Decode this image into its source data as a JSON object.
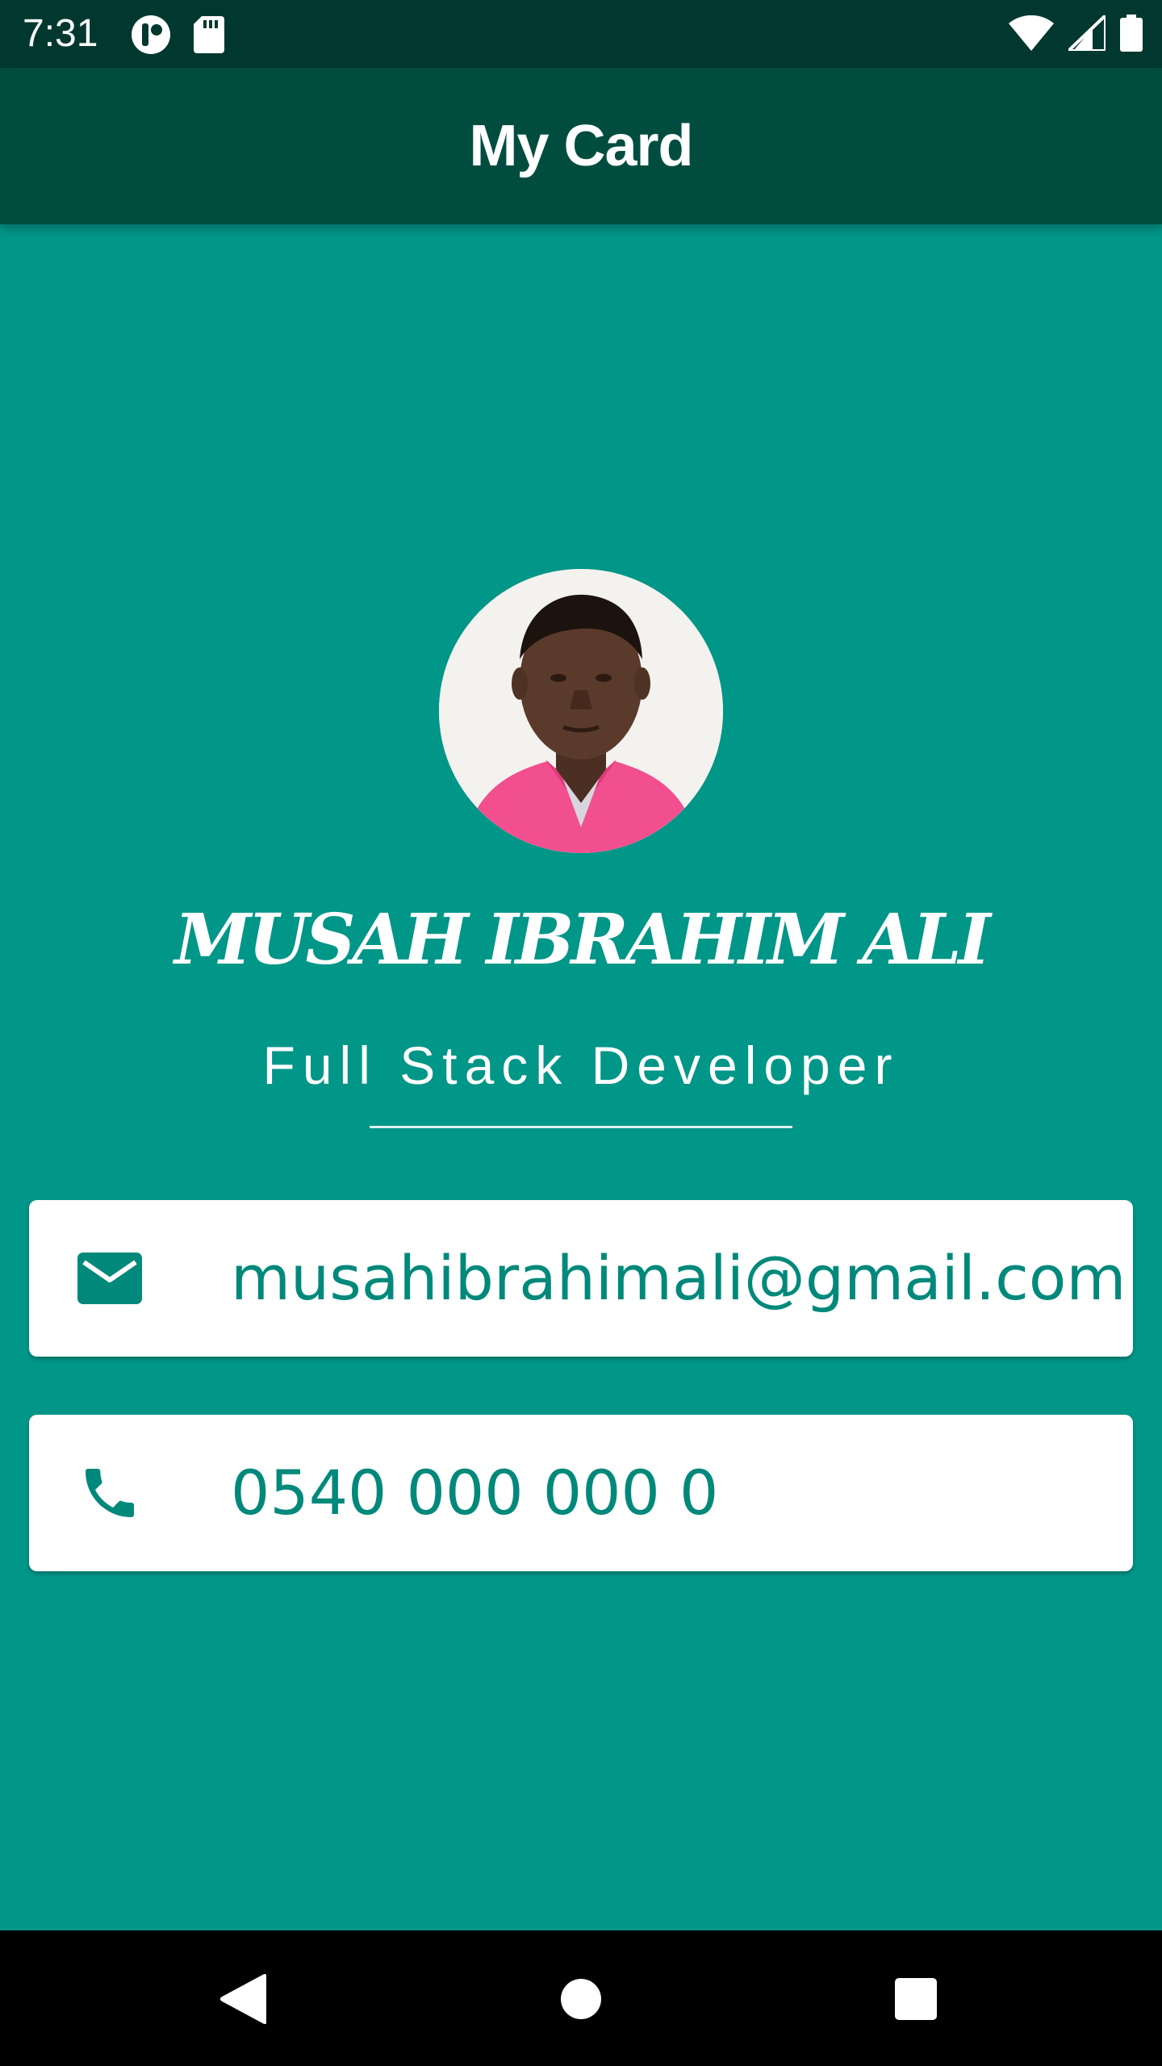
{
  "status_bar": {
    "time": "7:31",
    "icons": [
      "notification-app-icon",
      "sd-card-icon",
      "wifi-icon",
      "signal-icon",
      "battery-icon"
    ]
  },
  "app_bar": {
    "title": "My Card"
  },
  "profile": {
    "avatar": "profile-photo",
    "name": "MUSAH IBRAHIM ALI",
    "title": "Full Stack Developer"
  },
  "contacts": {
    "email": {
      "icon": "email-icon",
      "value": "musahibrahimali@gmail.com"
    },
    "phone": {
      "icon": "phone-icon",
      "value": "0540 000 000 0"
    }
  },
  "navigation": {
    "buttons": [
      "back-icon",
      "home-icon",
      "recents-icon"
    ]
  },
  "colors": {
    "status_bar": "#00382f",
    "app_bar": "#004d40",
    "background": "#009688",
    "card": "#ffffff",
    "accent_text": "#00897b",
    "nav_bar": "#000000"
  }
}
